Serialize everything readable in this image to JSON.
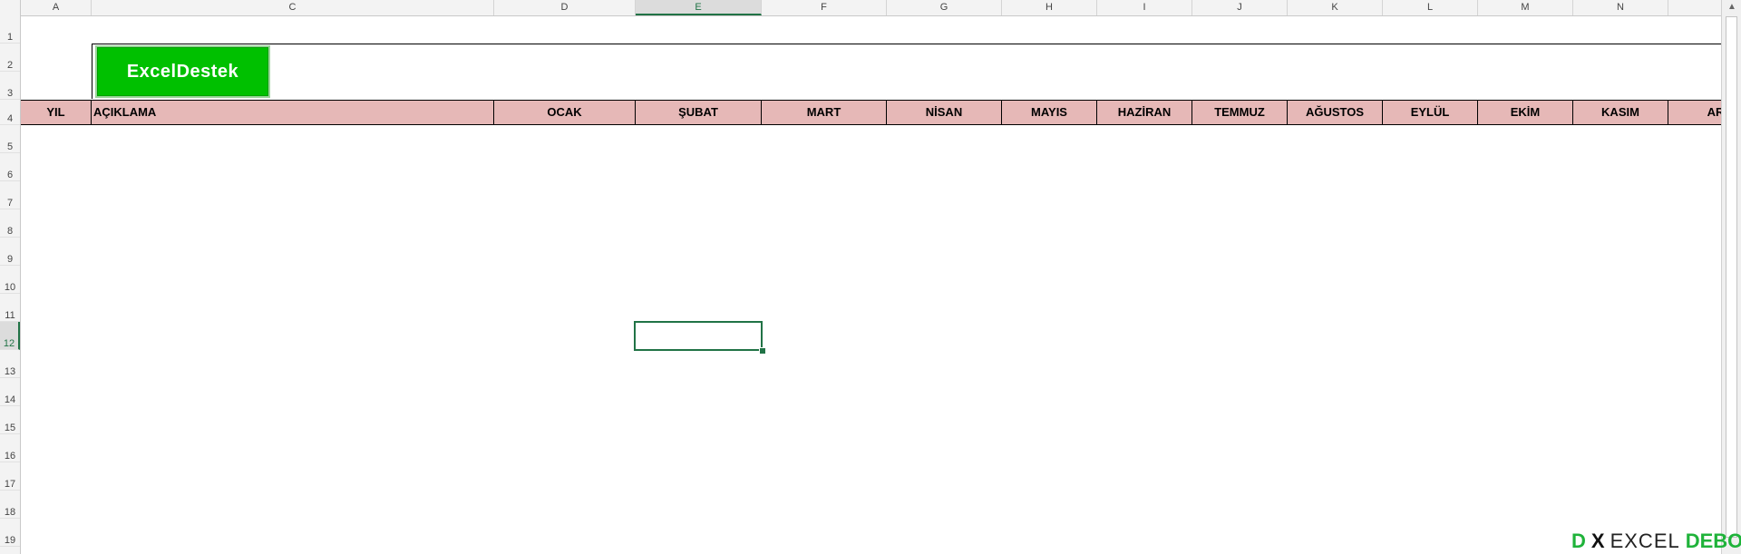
{
  "sheet": {
    "columns": [
      "A",
      "C",
      "D",
      "E",
      "F",
      "G",
      "H",
      "I",
      "J",
      "K",
      "L",
      "M",
      "N"
    ],
    "active_column": "E",
    "rows": [
      "1",
      "2",
      "3",
      "4",
      "5",
      "6",
      "7",
      "8",
      "9",
      "10",
      "11",
      "12",
      "13",
      "14",
      "15",
      "16",
      "17",
      "18",
      "19"
    ],
    "active_row": "12"
  },
  "logo": {
    "label": "ExcelDestek"
  },
  "table_header": [
    "YIL",
    "AÇIKLAMA",
    "OCAK",
    "ŞUBAT",
    "MART",
    "NİSAN",
    "MAYIS",
    "HAZİRAN",
    "TEMMUZ",
    "AĞUSTOS",
    "EYLÜL",
    "EKİM",
    "KASIM",
    "AR"
  ],
  "watermark": {
    "d": "D",
    "x": "X",
    "excel": "EXCEL",
    "debo": "DEBO"
  },
  "colors": {
    "accent": "#217346",
    "header_fill": "#e6b8b7",
    "logo_fill": "#00c000"
  }
}
